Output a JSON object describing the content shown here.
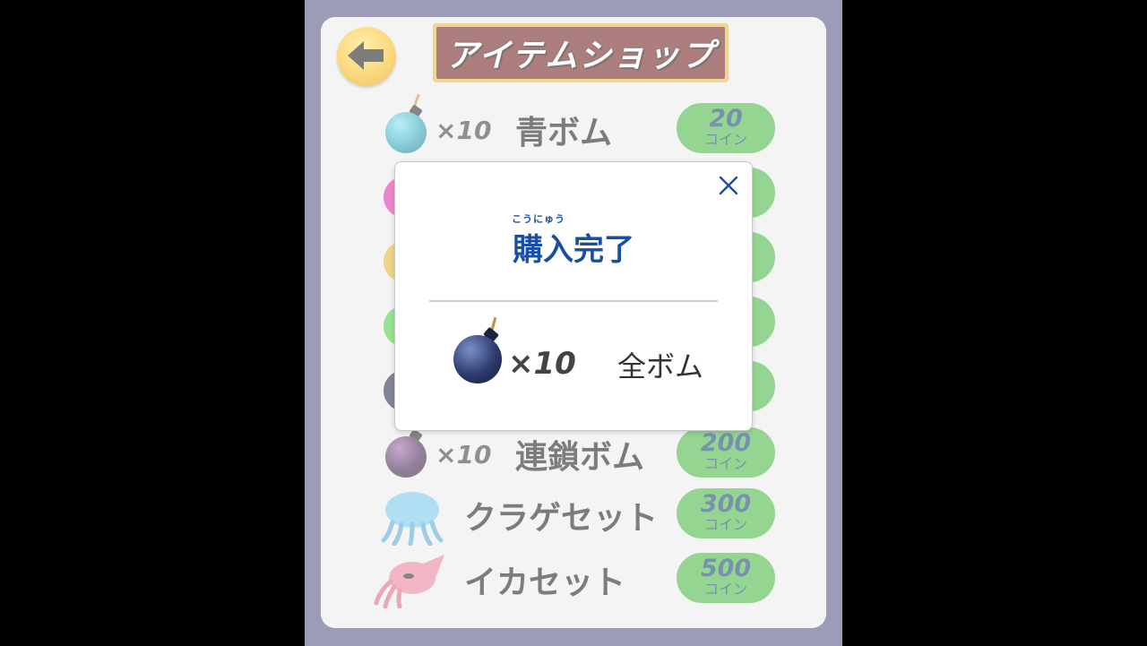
{
  "header": {
    "back_icon": "back-arrow-icon",
    "title": "アイテムショップ"
  },
  "shop_items": [
    {
      "qty": "×10",
      "name": "青ボム",
      "price": "20",
      "unit": "コイン",
      "icon": "blue-bomb-icon",
      "color": "#1fa2b6"
    },
    {
      "qty": "×10",
      "name": "連鎖ボム",
      "price": "200",
      "unit": "コイン",
      "icon": "chain-bomb-icon",
      "color": "#3a1744"
    },
    {
      "qty": "",
      "name": "クラゲセット",
      "price": "300",
      "unit": "コイン",
      "icon": "jellyfish-icon",
      "color": "#6fc3e8"
    },
    {
      "qty": "",
      "name": "イカセット",
      "price": "500",
      "unit": "コイン",
      "icon": "squid-icon",
      "color": "#e87b96"
    }
  ],
  "dialog": {
    "close_icon": "close-icon",
    "ruby": "こうにゅう",
    "title": "購入完了",
    "item_icon": "bomb-icon",
    "item_qty": "×10",
    "item_name": "全ボム"
  },
  "colors": {
    "background": "#000000",
    "stage": "#4b4a7f",
    "panel": "#ececec",
    "price_badge": "#3fb23a",
    "dialog_title": "#1a4fa0"
  }
}
